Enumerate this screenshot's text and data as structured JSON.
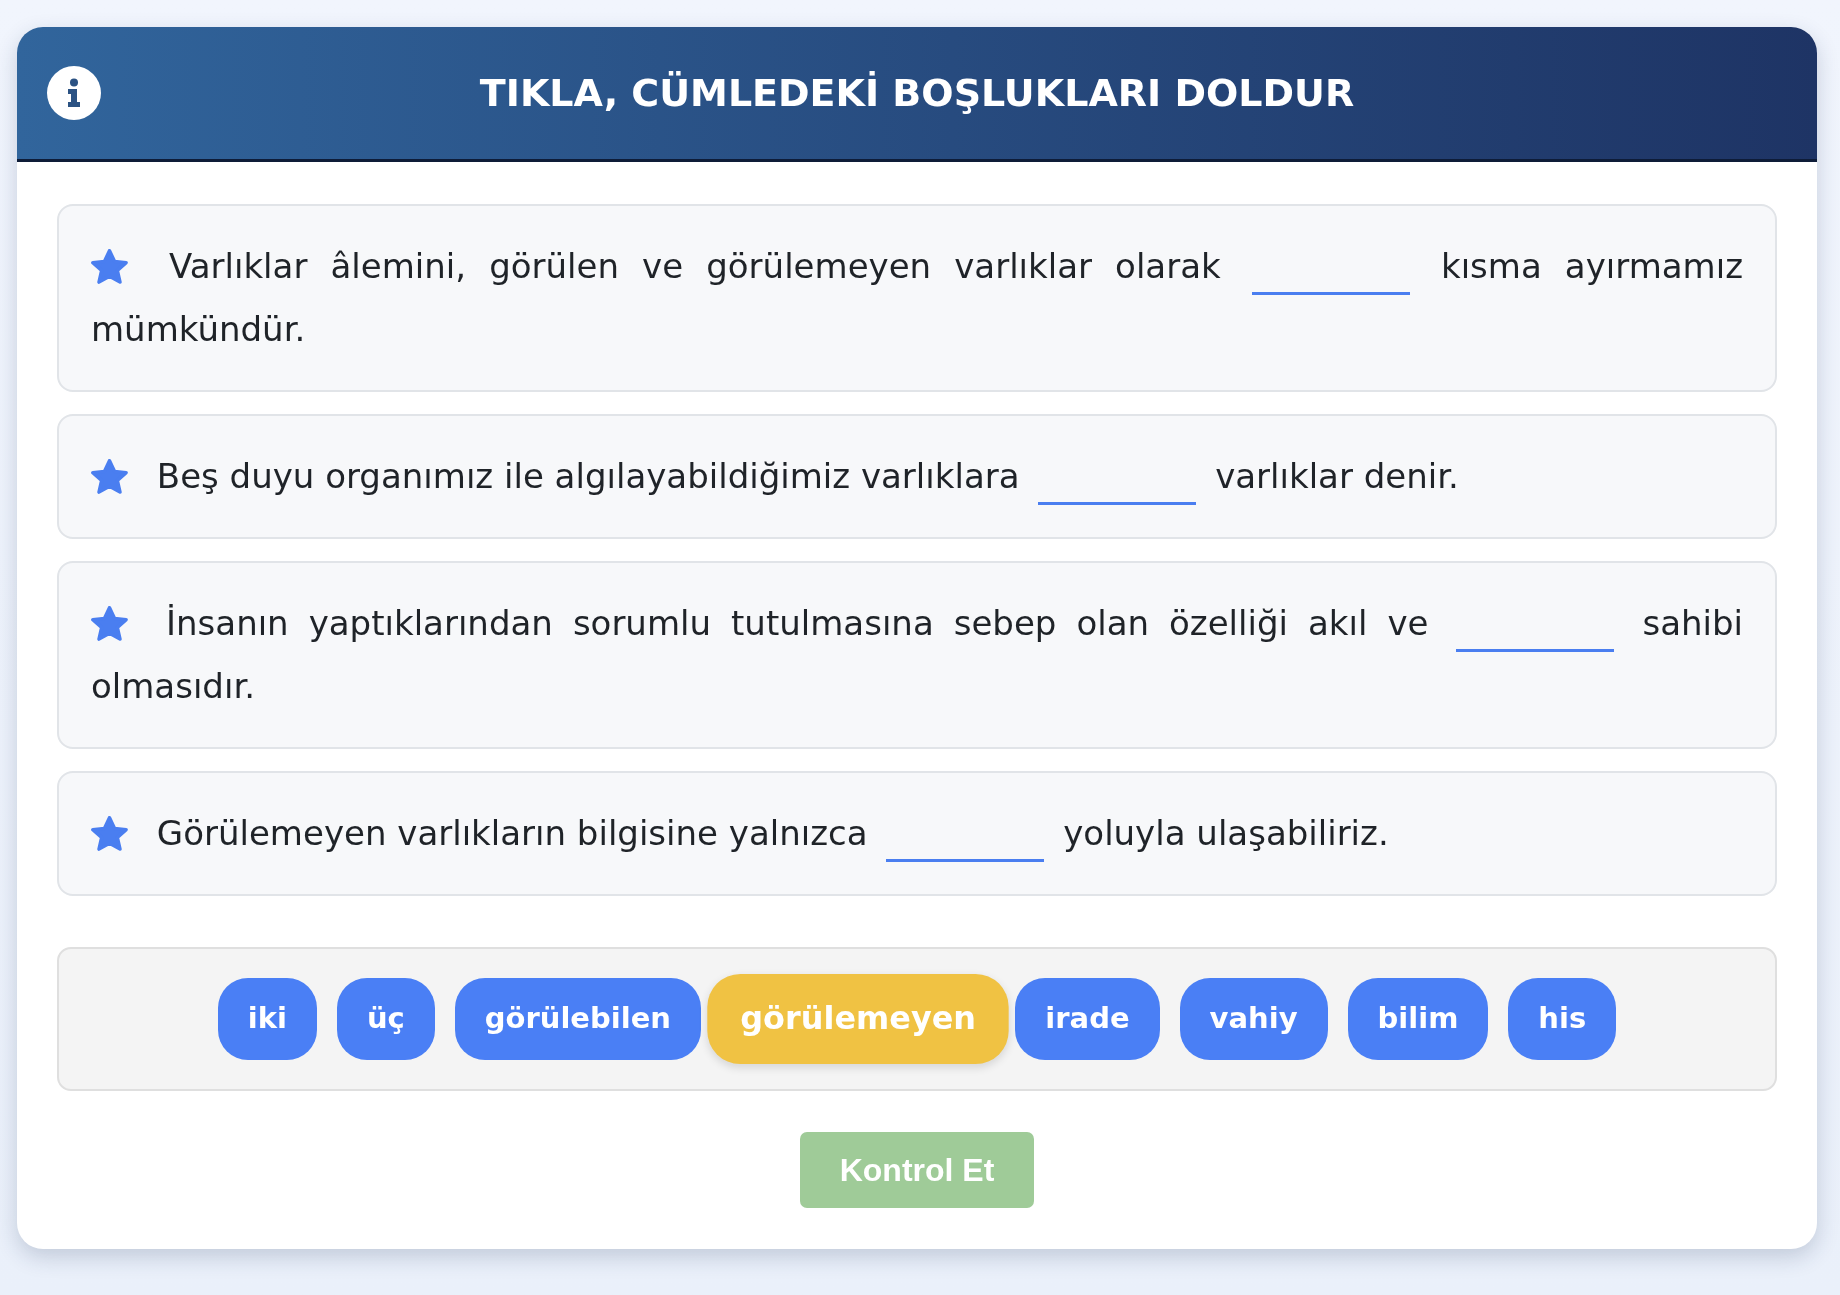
{
  "header": {
    "title": "TIKLA, CÜMLEDEKİ BOŞLUKLARI DOLDUR"
  },
  "sentences": [
    {
      "before": "Varlıklar âlemini, görülen ve görülemeyen varlıklar olarak",
      "after": [
        "kısma ayırmamız",
        "mümkündür."
      ]
    },
    {
      "before": "Beş duyu organımız ile algılayabildiğimiz varlıklara",
      "after": [
        "varlıklar denir."
      ]
    },
    {
      "before": "İnsanın yaptıklarından sorumlu tutulmasına sebep olan özelliği akıl ve",
      "after": [
        "sahibi",
        "olmasıdır."
      ]
    },
    {
      "before": "Görülemeyen varlıkların bilgisine yalnızca",
      "after": [
        "yoluyla ulaşabiliriz."
      ]
    }
  ],
  "word_bank": [
    {
      "label": "iki",
      "selected": false
    },
    {
      "label": "üç",
      "selected": false
    },
    {
      "label": "görülebilen",
      "selected": false
    },
    {
      "label": "görülemeyen",
      "selected": true
    },
    {
      "label": "irade",
      "selected": false
    },
    {
      "label": "vahiy",
      "selected": false
    },
    {
      "label": "bilim",
      "selected": false
    },
    {
      "label": "his",
      "selected": false
    }
  ],
  "check_button": {
    "label": "Kontrol Et",
    "disabled": true
  }
}
